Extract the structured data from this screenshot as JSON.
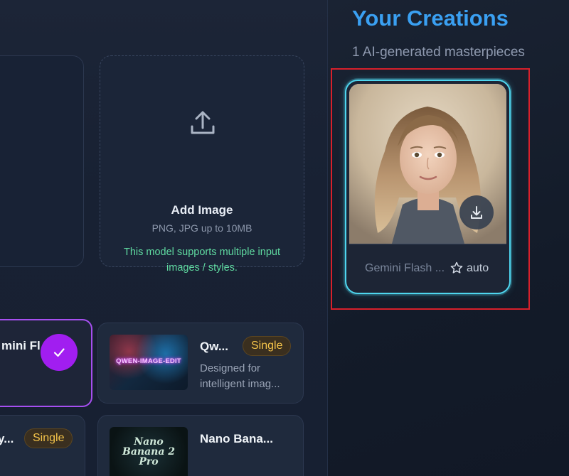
{
  "upload": {
    "title": "Add Image",
    "subtitle": "PNG, JPG up to 10MB",
    "note": "This model supports multiple input images / styles."
  },
  "models": {
    "gemini": {
      "name": "mini Fl"
    },
    "qwen": {
      "name": "Qw...",
      "badge": "Single",
      "description_line1": "Designed for",
      "description_line2": "intelligent imag...",
      "thumbnail_text": "QWEN-IMAGE-EDIT"
    },
    "bottom_left": {
      "name": "y...",
      "badge": "Single"
    },
    "nano": {
      "name": "Nano Bana...",
      "thumbnail_line1": "Nano",
      "thumbnail_line2": "Banana 2",
      "thumbnail_line3": "Pro"
    }
  },
  "creations": {
    "title": "Your Creations",
    "subtitle": "1 AI-generated masterpieces",
    "items": [
      {
        "model": "Gemini Flash ...",
        "aspect": "auto"
      }
    ]
  },
  "colors": {
    "accent_blue": "#3aa0f2",
    "selected_purple": "#a11ef0",
    "note_green": "#5fd9a0",
    "badge_gold": "#f3c34a",
    "card_glow": "#4fd6ef",
    "highlight_red": "#d8202b"
  }
}
